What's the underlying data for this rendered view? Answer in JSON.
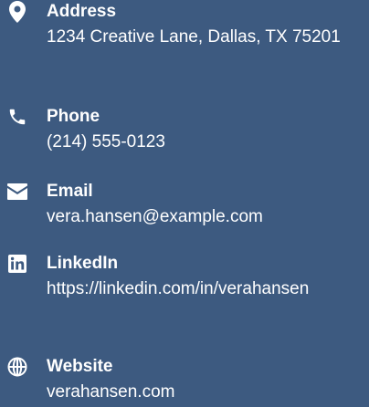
{
  "contact": {
    "address": {
      "label": "Address",
      "value": "1234 Creative Lane, Dallas, TX 75201",
      "icon": "map-pin-icon"
    },
    "phone": {
      "label": "Phone",
      "value": "(214) 555-0123",
      "icon": "phone-icon"
    },
    "email": {
      "label": "Email",
      "value": "vera.hansen@example.com",
      "icon": "envelope-icon"
    },
    "linkedin": {
      "label": "LinkedIn",
      "value": "https://linkedin.com/in/verahansen",
      "icon": "linkedin-icon"
    },
    "website": {
      "label": "Website",
      "value": "verahansen.com",
      "icon": "globe-icon"
    }
  },
  "colors": {
    "background": "#3d5a80",
    "text": "#ffffff"
  }
}
